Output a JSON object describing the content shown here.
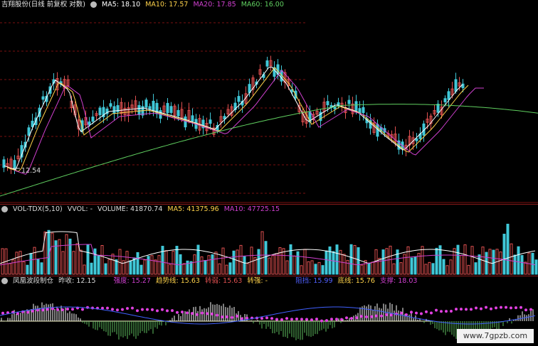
{
  "colors": {
    "up": "#e05050",
    "down": "#40c8d8",
    "ma5": "#ffffff",
    "ma10": "#ffd24a",
    "ma20": "#d040d0",
    "ma60": "#60d060",
    "grid": "#7a1010"
  },
  "main": {
    "stock_name": "吉翔股份(日线 前复权 对数)",
    "ma5_label": "MA5: 18.10",
    "ma10_label": "MA10: 17.57",
    "ma20_label": "MA20: 17.85",
    "ma60_label": "MA60: 16.00",
    "low_label": "12.54"
  },
  "volume": {
    "indicator": "VOL-TDX(5,10)",
    "vvol": "VVOL: -",
    "volume": "VOLUME: 41870.74",
    "ma5": "MA5: 41375.96",
    "ma10": "MA10: 47725.15"
  },
  "custom": {
    "name": "凤凰波段制仓",
    "prev_close": "昨收: 12.15",
    "strong": "强度: 15.27",
    "trend": "趋势线: 15.63",
    "weak": "转弱: 15.63",
    "turn_strong": "转强: -",
    "pressure": "阻挡: 15.99",
    "bottom": "底线: 15.76",
    "support": "支撑: 18.03"
  },
  "watermark": "www.7gpzb.com"
}
